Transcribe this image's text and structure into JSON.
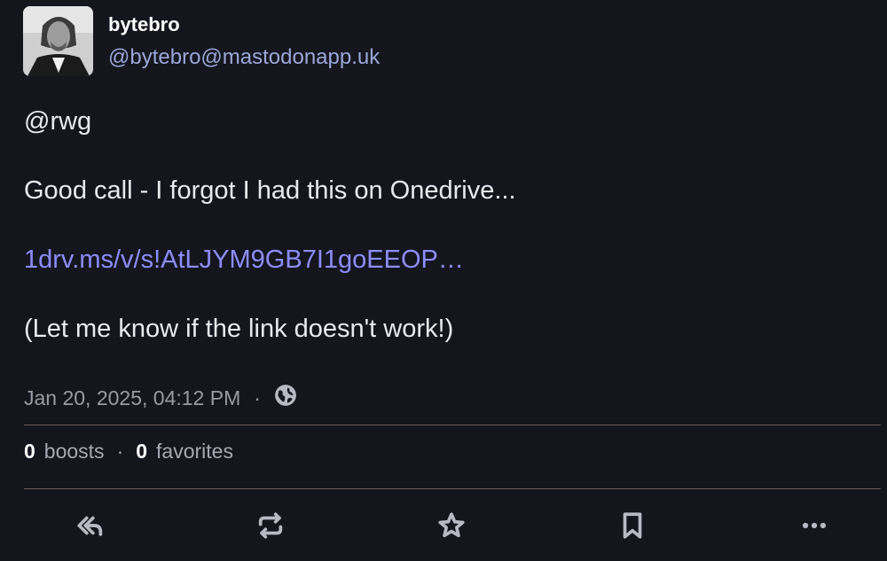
{
  "author": {
    "display_name": "bytebro",
    "acct": "@bytebro@mastodonapp.uk"
  },
  "post": {
    "mention": "@rwg",
    "line1": "Good call - I forgot I had this on Onedrive...",
    "link_text": "1drv.ms/v/s!AtLJYM9GB7I1goEEOP…",
    "line3": "(Let me know if the link doesn't work!)"
  },
  "meta": {
    "timestamp": "Jan 20, 2025, 04:12 PM",
    "separator": "·",
    "visibility_icon": "globe-icon"
  },
  "stats": {
    "boosts_count": "0",
    "boosts_label": "boosts",
    "separator": "·",
    "favorites_count": "0",
    "favorites_label": "favorites"
  },
  "actions": [
    "reply-all-icon",
    "boost-icon",
    "favorite-star-icon",
    "bookmark-icon",
    "more-icon"
  ],
  "colors": {
    "background": "#15151d",
    "link": "#8c8dff",
    "acct": "#9aa7d8",
    "muted": "#9a9aa6"
  }
}
